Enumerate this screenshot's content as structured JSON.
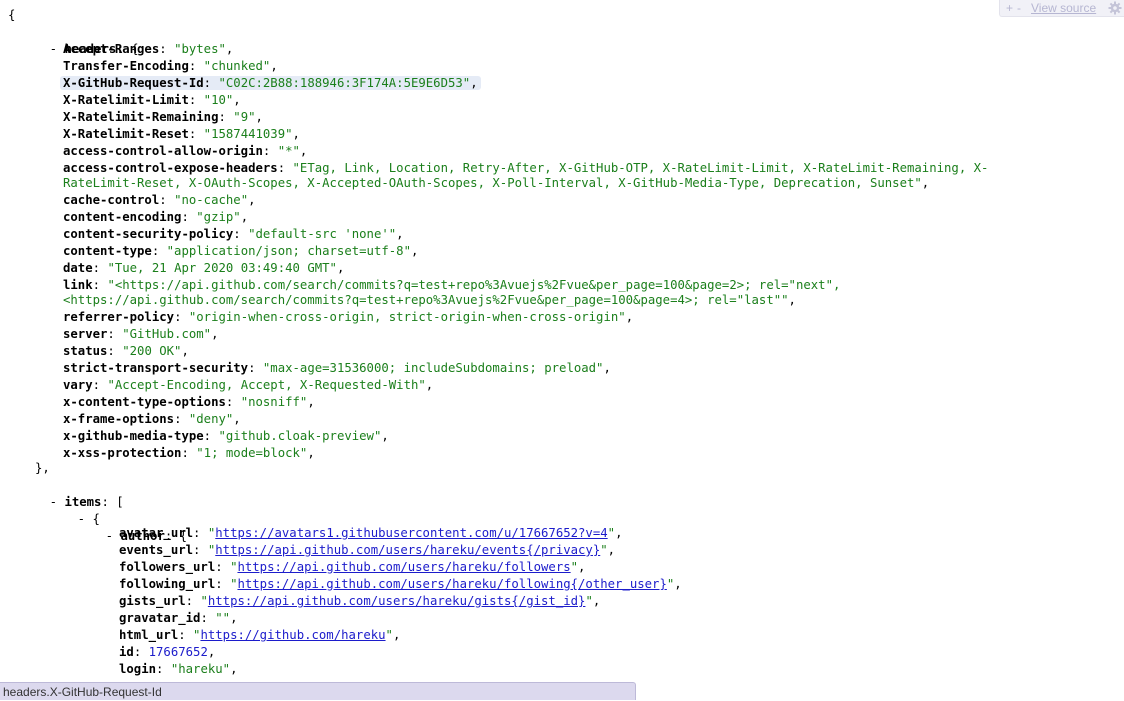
{
  "toolbar": {
    "plus": "+",
    "minus": "-",
    "view_source": "View source",
    "settings_icon": "gear-icon"
  },
  "status_path": "headers.X-GitHub-Request-Id",
  "colors": {
    "string": "#1b7f1b",
    "number": "#1c1ccb",
    "link": "#1c1ccb",
    "highlight": "#e5ebf6",
    "statusbar": "#dcd9ee"
  },
  "json_document": {
    "open_brace": "{",
    "headers": {
      "key": "headers",
      "fields": [
        {
          "key": "Accept-Ranges",
          "value": "\"bytes\""
        },
        {
          "key": "Transfer-Encoding",
          "value": "\"chunked\""
        },
        {
          "key": "X-GitHub-Request-Id",
          "value": "\"C02C:2B88:188946:3F174A:5E9E6D53\""
        },
        {
          "key": "X-Ratelimit-Limit",
          "value": "\"10\""
        },
        {
          "key": "X-Ratelimit-Remaining",
          "value": "\"9\""
        },
        {
          "key": "X-Ratelimit-Reset",
          "value": "\"1587441039\""
        },
        {
          "key": "access-control-allow-origin",
          "value": "\"*\""
        },
        {
          "key": "access-control-expose-headers",
          "value": "\"ETag, Link, Location, Retry-After, X-GitHub-OTP, X-RateLimit-Limit, X-RateLimit-Remaining, X-",
          "value_cont": "RateLimit-Reset, X-OAuth-Scopes, X-Accepted-OAuth-Scopes, X-Poll-Interval, X-GitHub-Media-Type, Deprecation, Sunset\""
        },
        {
          "key": "cache-control",
          "value": "\"no-cache\""
        },
        {
          "key": "content-encoding",
          "value": "\"gzip\""
        },
        {
          "key": "content-security-policy",
          "value": "\"default-src 'none'\""
        },
        {
          "key": "content-type",
          "value": "\"application/json; charset=utf-8\""
        },
        {
          "key": "date",
          "value": "\"Tue, 21 Apr 2020 03:49:40 GMT\""
        },
        {
          "key": "link",
          "value": "\"<https://api.github.com/search/commits?q=test+repo%3Avuejs%2Fvue&per_page=100&page=2>; rel=\"next\",",
          "value_cont": "<https://api.github.com/search/commits?q=test+repo%3Avuejs%2Fvue&per_page=100&page=4>; rel=\"last\"\""
        },
        {
          "key": "referrer-policy",
          "value": "\"origin-when-cross-origin, strict-origin-when-cross-origin\""
        },
        {
          "key": "server",
          "value": "\"GitHub.com\""
        },
        {
          "key": "status",
          "value": "\"200 OK\""
        },
        {
          "key": "strict-transport-security",
          "value": "\"max-age=31536000; includeSubdomains; preload\""
        },
        {
          "key": "vary",
          "value": "\"Accept-Encoding, Accept, X-Requested-With\""
        },
        {
          "key": "x-content-type-options",
          "value": "\"nosniff\""
        },
        {
          "key": "x-frame-options",
          "value": "\"deny\""
        },
        {
          "key": "x-github-media-type",
          "value": "\"github.cloak-preview\""
        },
        {
          "key": "x-xss-protection",
          "value": "\"1; mode=block\""
        }
      ],
      "close": "},"
    },
    "items": {
      "key": "items",
      "open": "[",
      "item_open": "{",
      "author": {
        "key": "author",
        "fields": [
          {
            "key": "avatar_url",
            "link": "https://avatars1.githubusercontent.com/u/17667652?v=4"
          },
          {
            "key": "events_url",
            "link": "https://api.github.com/users/hareku/events{/privacy}"
          },
          {
            "key": "followers_url",
            "link": "https://api.github.com/users/hareku/followers"
          },
          {
            "key": "following_url",
            "link": "https://api.github.com/users/hareku/following{/other_user}"
          },
          {
            "key": "gists_url",
            "link": "https://api.github.com/users/hareku/gists{/gist_id}"
          },
          {
            "key": "gravatar_id",
            "value": "\"\""
          },
          {
            "key": "html_url",
            "link": "https://github.com/hareku"
          },
          {
            "key": "id",
            "number": "17667652"
          },
          {
            "key": "login",
            "value": "\"hareku\""
          }
        ]
      }
    }
  }
}
